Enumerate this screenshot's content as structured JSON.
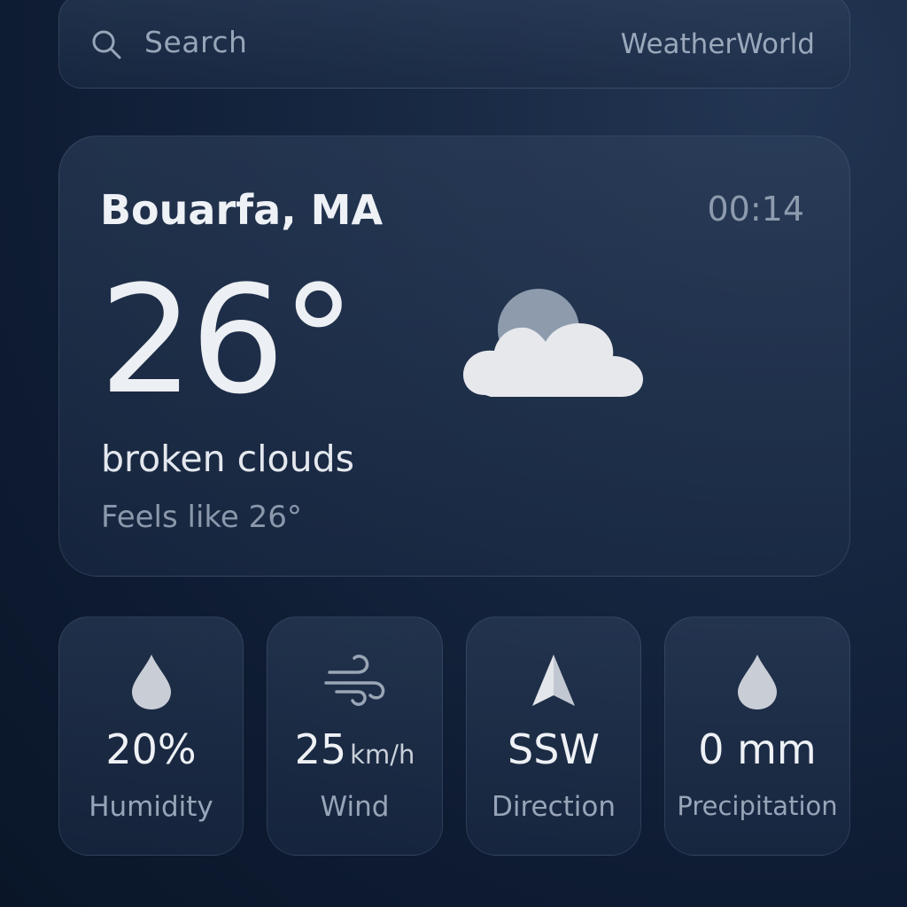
{
  "search": {
    "placeholder": "Search",
    "brand": "WeatherWorld"
  },
  "current": {
    "location": "Bouarfa, MA",
    "time": "00:14",
    "temperature": "26°",
    "condition": "broken clouds",
    "feels_like": "Feels like 26°",
    "icon": "broken-clouds-icon"
  },
  "stats": [
    {
      "icon": "droplet-icon",
      "value": "20%",
      "unit": "",
      "label": "Humidity"
    },
    {
      "icon": "wind-icon",
      "value": "25",
      "unit": "km/h",
      "label": "Wind"
    },
    {
      "icon": "direction-arrow-icon",
      "value": "SSW",
      "unit": "",
      "label": "Direction"
    },
    {
      "icon": "droplet-icon",
      "value": "0 mm",
      "unit": "",
      "label": "Precipitation"
    }
  ],
  "colors": {
    "background": "#0d1a30",
    "card": "#1e2e48",
    "primary_text": "#eef1f5",
    "secondary_text": "#8e9bae",
    "icon_fill": "#c9ced6"
  }
}
